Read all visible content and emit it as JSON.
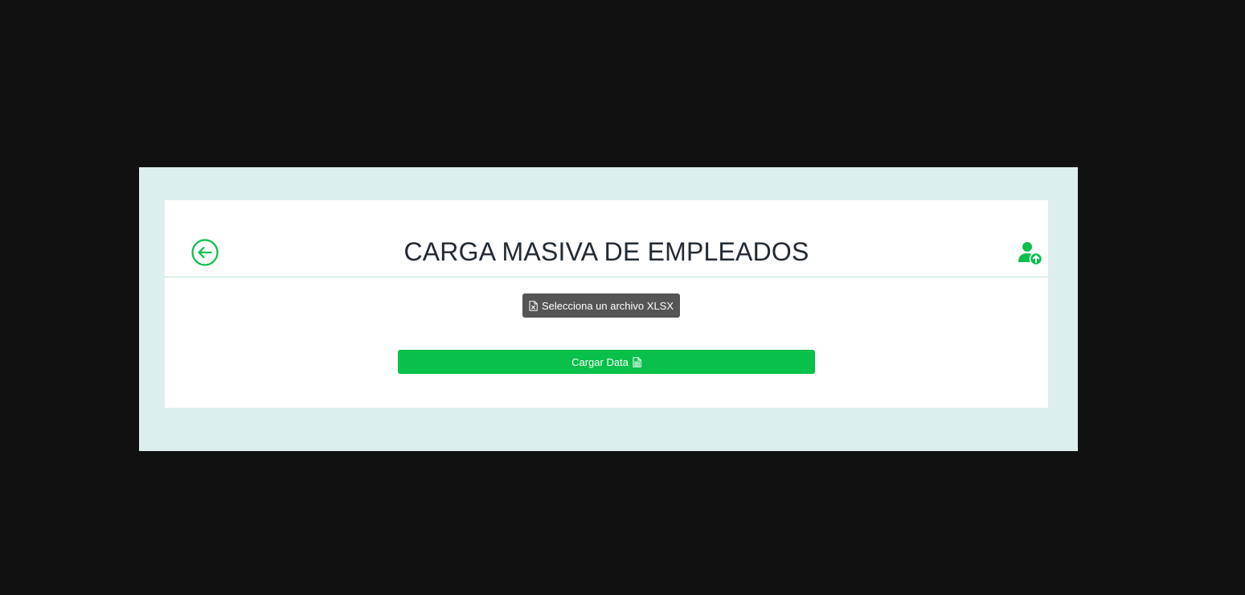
{
  "page": {
    "title": "CARGA MASIVA DE EMPLEADOS"
  },
  "header": {
    "back_icon": "arrow-left-circle-icon",
    "upload_icon": "user-upload-icon"
  },
  "file_input": {
    "label": "Selecciona un archivo XLSX",
    "icon": "file-excel-icon"
  },
  "actions": {
    "load_label": "Cargar Data",
    "load_icon": "file-spreadsheet-icon"
  },
  "colors": {
    "accent": "#08c04a",
    "panel_bg": "#dcefec",
    "outer_bg": "#111111",
    "file_button_bg": "#555555"
  }
}
